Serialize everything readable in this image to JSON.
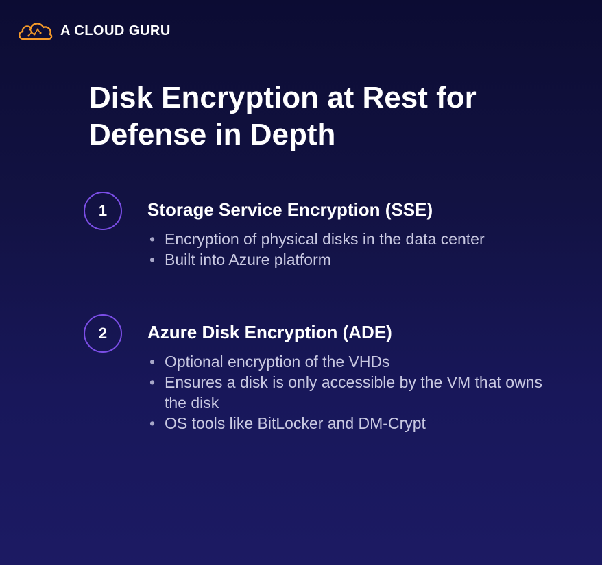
{
  "brand": {
    "name": "A CLOUD GURU",
    "accent_color": "#f59a29"
  },
  "slide": {
    "title": "Disk Encryption at Rest for Defense in Depth",
    "sections": [
      {
        "number": "1",
        "heading": "Storage Service Encryption (SSE)",
        "bullets": [
          "Encryption of physical disks in the data center",
          "Built into Azure platform"
        ]
      },
      {
        "number": "2",
        "heading": "Azure Disk Encryption (ADE)",
        "bullets": [
          "Optional encryption of the VHDs",
          "Ensures a disk is only accessible by the VM that owns the disk",
          "OS tools like BitLocker and DM-Crypt"
        ]
      }
    ]
  },
  "colors": {
    "background_top": "#0c0c33",
    "background_bottom": "#1c1a63",
    "circle_border": "#7b4ee6",
    "bullet_text": "#c9c9e2"
  }
}
